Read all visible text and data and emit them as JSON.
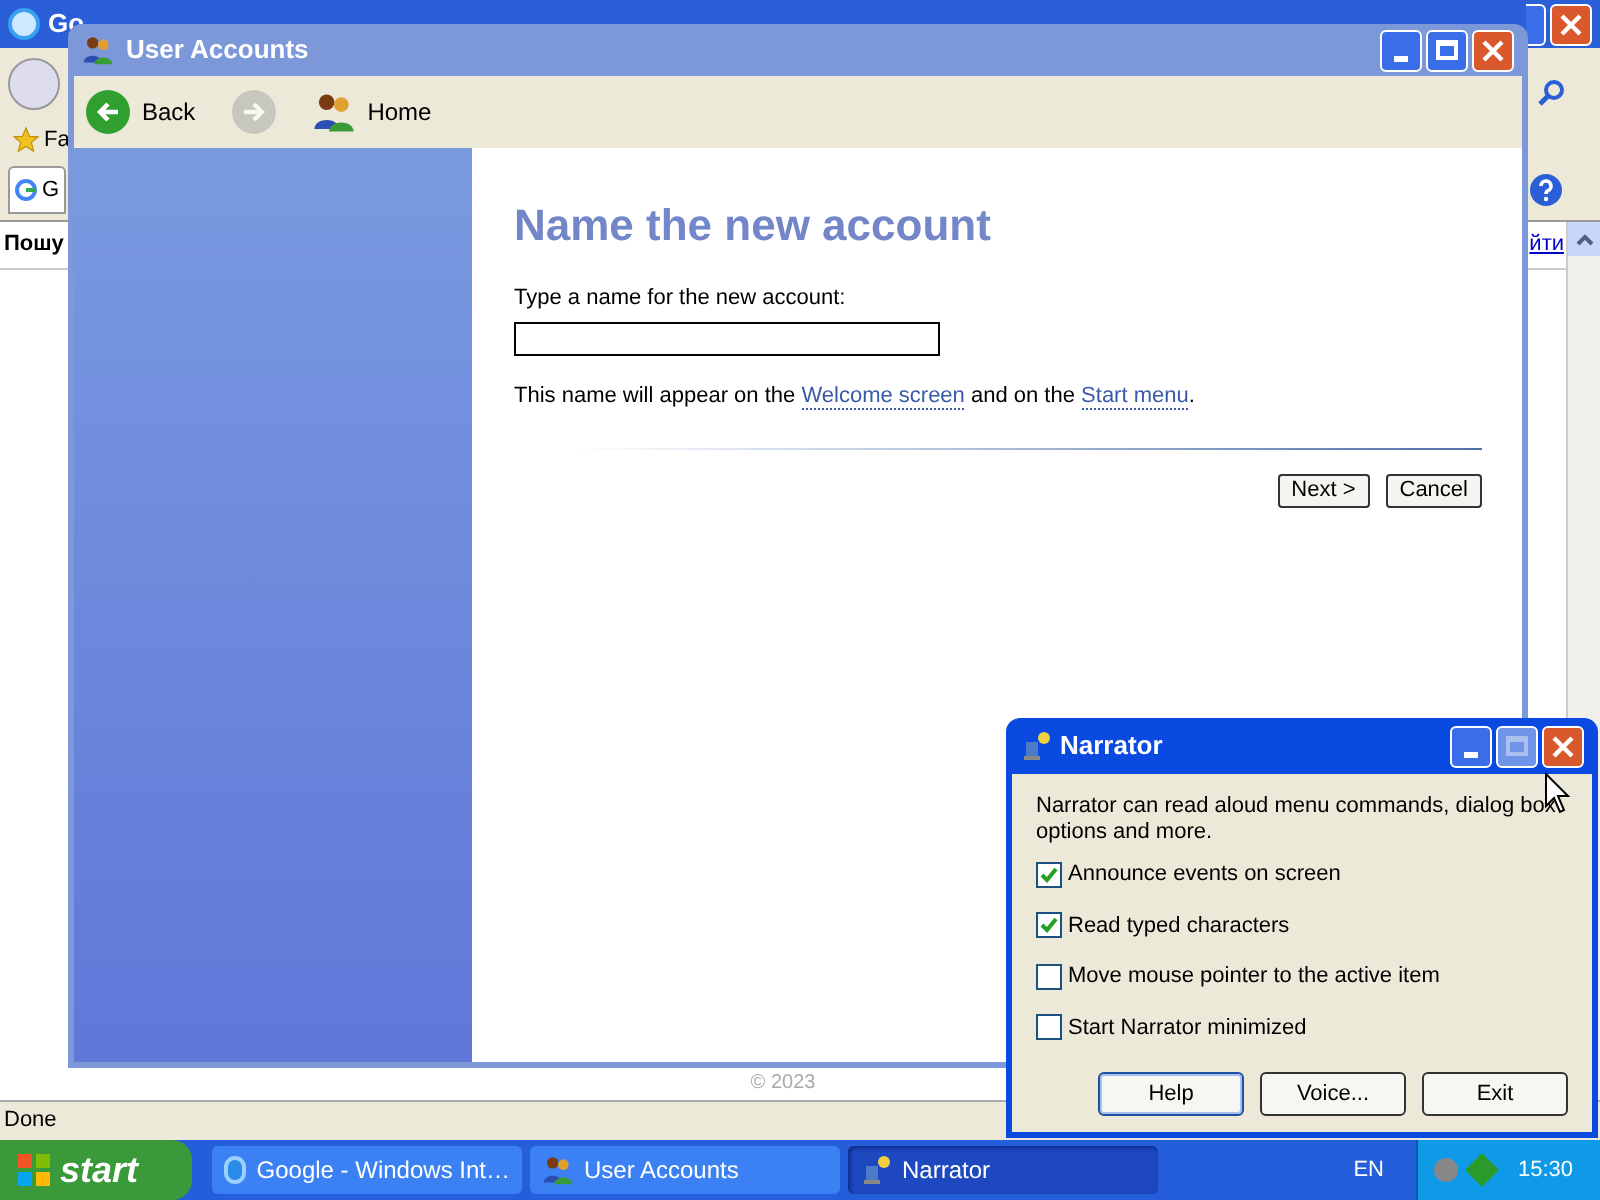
{
  "browser": {
    "title": "Go",
    "favorites": "Fa",
    "tab": "G",
    "search_text": "Пошу",
    "link": "йти",
    "footer": "© 2023",
    "status": "Done"
  },
  "user_accounts": {
    "title": "User Accounts",
    "toolbar": [
      {
        "label": "Back",
        "kind": "back",
        "disabled": false
      },
      {
        "kind": "forward",
        "disabled": true
      },
      {
        "label": "Home",
        "kind": "home",
        "disabled": false
      }
    ],
    "heading": "Name the new account",
    "field_label": "Type a name for the new account:",
    "note": "This name will appear on the",
    "link_1": "Welcome screen",
    "note_mid": "and on the",
    "link_2": "Start menu",
    "note_end": ".",
    "buttons": [
      "Next >",
      "Cancel"
    ]
  },
  "narrator": {
    "title": "Narrator",
    "description": "Narrator can read aloud menu commands, dialog box options and more.",
    "options": [
      {
        "label": "Announce events on screen",
        "checked": true
      },
      {
        "label": "Read typed characters",
        "checked": true
      },
      {
        "label": "Move mouse pointer to the active item",
        "checked": false
      },
      {
        "label": "Start Narrator minimized",
        "checked": false
      }
    ],
    "buttons": [
      "Help",
      "Voice...",
      "Exit"
    ]
  },
  "taskbar": {
    "start": "start",
    "tasks": [
      {
        "label": "Google - Windows Int…",
        "kind": "ie",
        "selected": false
      },
      {
        "label": "User Accounts",
        "kind": "users",
        "selected": false
      },
      {
        "label": "Narrator",
        "kind": "narrator",
        "selected": true
      }
    ],
    "language": "EN",
    "clock": "15:30"
  }
}
